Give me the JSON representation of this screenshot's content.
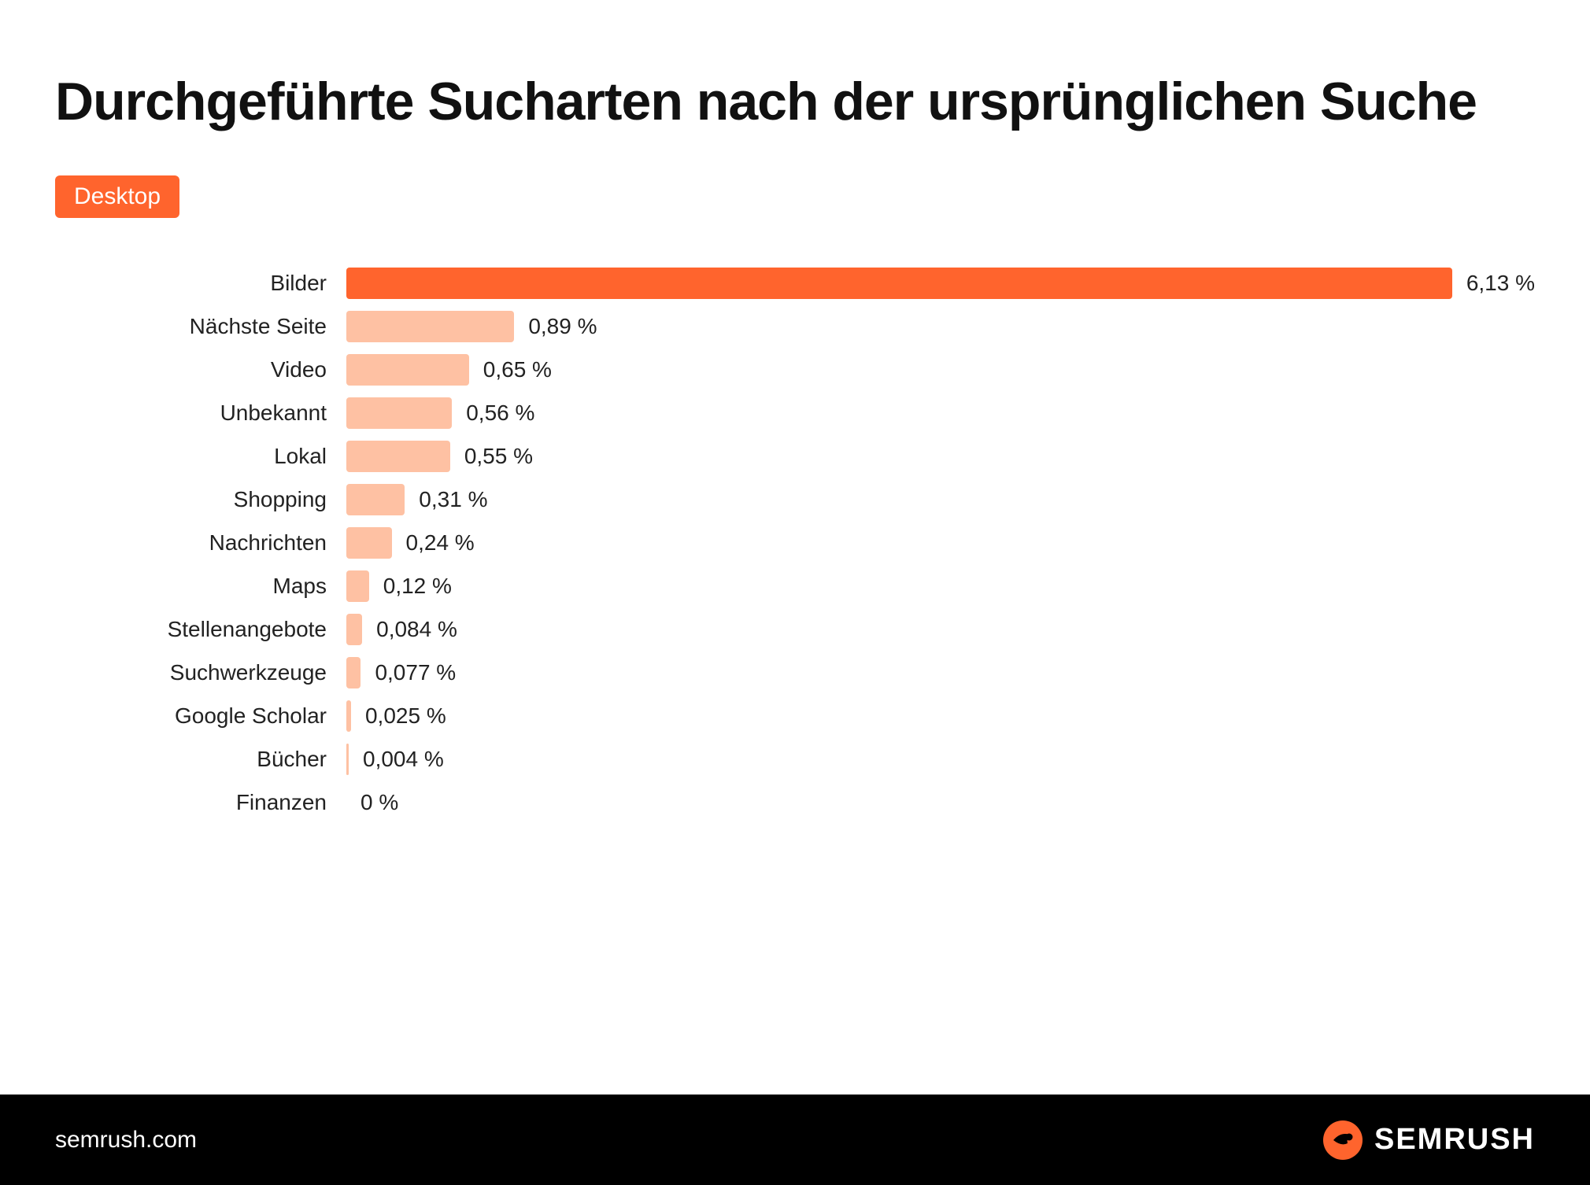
{
  "title": "Durchgeführte Sucharten nach der ursprünglichen Suche",
  "tag_label": "Desktop",
  "footer_url": "semrush.com",
  "brand_name": "SEMRUSH",
  "chart_data": {
    "type": "bar",
    "title": "Durchgeführte Sucharten nach der ursprünglichen Suche",
    "xlabel": "",
    "ylabel": "",
    "categories": [
      "Bilder",
      "Nächste Seite",
      "Video",
      "Unbekannt",
      "Lokal",
      "Shopping",
      "Nachrichten",
      "Maps",
      "Stellenangebote",
      "Suchwerkzeuge",
      "Google Scholar",
      "Bücher",
      "Finanzen"
    ],
    "values": [
      6.13,
      0.89,
      0.65,
      0.56,
      0.55,
      0.31,
      0.24,
      0.12,
      0.084,
      0.077,
      0.025,
      0.004,
      0
    ],
    "value_labels": [
      "6,13 %",
      "0,89 %",
      "0,65 %",
      "0,56 %",
      "0,55 %",
      "0,31 %",
      "0,24 %",
      "0,12 %",
      "0,084 %",
      "0,077 %",
      "0,025 %",
      "0,004 %",
      "0 %"
    ],
    "highlight_index": 0,
    "xlim": [
      0,
      6.3
    ]
  },
  "colors": {
    "accent": "#ff642d",
    "bar_light": "#fec1a3"
  }
}
